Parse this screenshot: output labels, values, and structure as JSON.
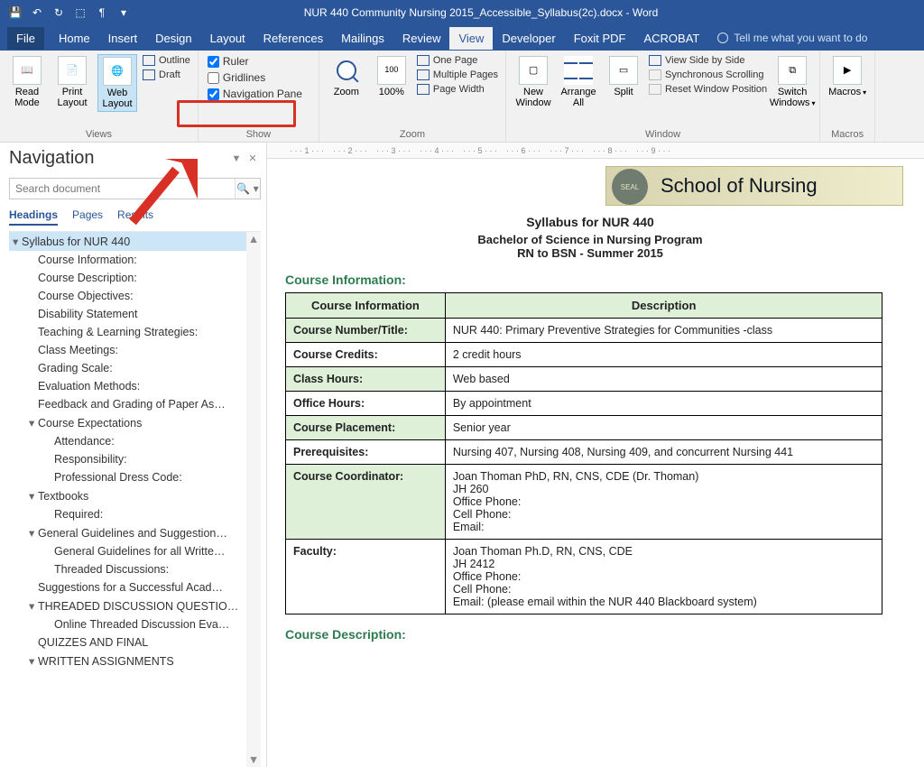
{
  "titlebar": {
    "title": "NUR 440 Community Nursing 2015_Accessible_Syllabus(2c).docx - Word"
  },
  "tabs": {
    "file": "File",
    "items": [
      "Home",
      "Insert",
      "Design",
      "Layout",
      "References",
      "Mailings",
      "Review",
      "View",
      "Developer",
      "Foxit PDF",
      "ACROBAT"
    ],
    "active": "View",
    "tell_me": "Tell me what you want to do"
  },
  "ribbon": {
    "views": {
      "label": "Views",
      "read": "Read Mode",
      "print": "Print Layout",
      "web": "Web Layout",
      "outline": "Outline",
      "draft": "Draft"
    },
    "show": {
      "label": "Show",
      "ruler": "Ruler",
      "gridlines": "Gridlines",
      "navpane": "Navigation Pane",
      "ruler_checked": true,
      "gridlines_checked": false,
      "navpane_checked": true
    },
    "zoom": {
      "label": "Zoom",
      "zoom": "Zoom",
      "pct": "100%",
      "onepage": "One Page",
      "multipage": "Multiple Pages",
      "pagewidth": "Page Width"
    },
    "window": {
      "label": "Window",
      "new": "New Window",
      "arrange": "Arrange All",
      "split": "Split",
      "side": "View Side by Side",
      "sync": "Synchronous Scrolling",
      "reset": "Reset Window Position",
      "switch": "Switch Windows"
    },
    "macros": {
      "label": "Macros",
      "macros": "Macros"
    }
  },
  "nav": {
    "title": "Navigation",
    "search_placeholder": "Search document",
    "tabs": {
      "headings": "Headings",
      "pages": "Pages",
      "results": "Results"
    },
    "items": [
      {
        "t": "Syllabus for NUR 440",
        "ind": 1,
        "caret": "▾",
        "sel": true
      },
      {
        "t": "Course Information:",
        "ind": 2
      },
      {
        "t": "Course Description:",
        "ind": 2
      },
      {
        "t": "Course Objectives:",
        "ind": 2
      },
      {
        "t": "Disability Statement",
        "ind": 2
      },
      {
        "t": "Teaching & Learning Strategies:",
        "ind": 2
      },
      {
        "t": "Class Meetings:",
        "ind": 2
      },
      {
        "t": "Grading Scale:",
        "ind": 2
      },
      {
        "t": "Evaluation Methods:",
        "ind": 2
      },
      {
        "t": "Feedback and Grading of Paper As…",
        "ind": 2
      },
      {
        "t": "Course Expectations",
        "ind": 2,
        "caret": "▾"
      },
      {
        "t": "Attendance:",
        "ind": 3
      },
      {
        "t": "Responsibility:",
        "ind": 3
      },
      {
        "t": "Professional Dress Code:",
        "ind": 3
      },
      {
        "t": "Textbooks",
        "ind": 2,
        "caret": "▾"
      },
      {
        "t": "Required:",
        "ind": 3
      },
      {
        "t": "General Guidelines and Suggestion…",
        "ind": 2,
        "caret": "▾"
      },
      {
        "t": "General Guidelines for all Writte…",
        "ind": 3
      },
      {
        "t": "Threaded Discussions:",
        "ind": 3
      },
      {
        "t": "Suggestions for a Successful Acad…",
        "ind": 2
      },
      {
        "t": "THREADED DISCUSSION QUESTIO…",
        "ind": 2,
        "caret": "▾"
      },
      {
        "t": "Online Threaded Discussion Eva…",
        "ind": 3
      },
      {
        "t": "QUIZZES AND FINAL",
        "ind": 2
      },
      {
        "t": "WRITTEN ASSIGNMENTS",
        "ind": 2,
        "caret": "▾"
      }
    ]
  },
  "ruler": [
    "1",
    "2",
    "3",
    "4",
    "5",
    "6",
    "7",
    "8",
    "9"
  ],
  "doc": {
    "banner": "School of Nursing",
    "title": "Syllabus for NUR 440",
    "sub1": "Bachelor of Science in Nursing Program",
    "sub2": "RN to BSN  -  Summer 2015",
    "section1": "Course Information:",
    "section2": "Course Description:",
    "th1": "Course Information",
    "th2": "Description",
    "rows": [
      {
        "l": "Course Number/Title:",
        "r": "NUR 440: Primary Preventive Strategies for Communities -class",
        "g": true
      },
      {
        "l": "Course Credits:",
        "r": "2 credit hours"
      },
      {
        "l": "Class Hours:",
        "r": "Web based",
        "g": true
      },
      {
        "l": "Office Hours:",
        "r": "By appointment"
      },
      {
        "l": "Course Placement:",
        "r": "Senior year",
        "g": true
      },
      {
        "l": "Prerequisites:",
        "r": "Nursing 407, Nursing 408, Nursing 409, and concurrent Nursing 441"
      },
      {
        "l": "Course Coordinator:",
        "r": "Joan Thoman PhD, RN, CNS, CDE (Dr. Thoman)\nJH 260\nOffice Phone:\nCell Phone:\nEmail:",
        "g": true
      },
      {
        "l": "Faculty:",
        "r": "Joan Thoman Ph.D, RN, CNS, CDE\nJH 2412\nOffice Phone:\nCell Phone:\nEmail:                                   (please email within the NUR 440 Blackboard system)"
      }
    ]
  }
}
